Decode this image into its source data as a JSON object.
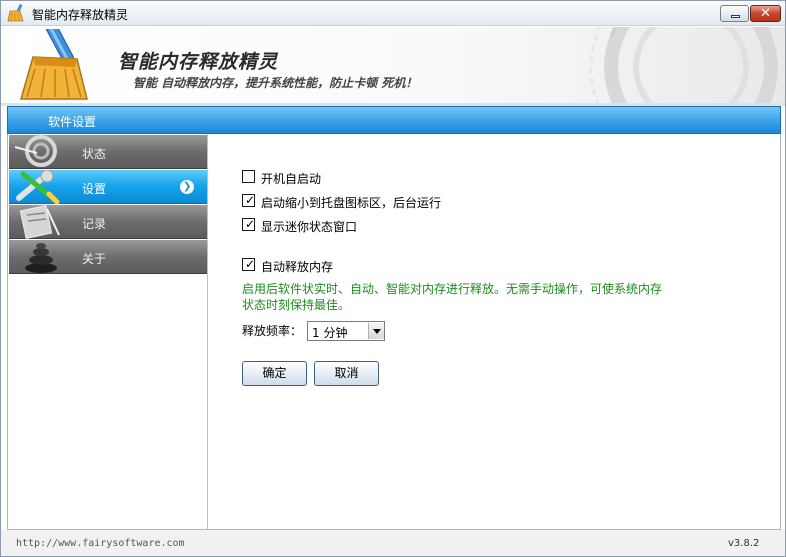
{
  "window": {
    "title": "智能内存释放精灵"
  },
  "header": {
    "app_name": "智能内存释放精灵",
    "slogan": "智能 自动释放内存，提升系统性能，防止卡顿 死机！"
  },
  "section": {
    "label": "软件设置"
  },
  "sidebar": {
    "items": [
      {
        "label": "状态",
        "icon": "status-icon",
        "active": false
      },
      {
        "label": "设置",
        "icon": "settings-icon",
        "active": true
      },
      {
        "label": "记录",
        "icon": "log-icon",
        "active": false
      },
      {
        "label": "关于",
        "icon": "about-icon",
        "active": false
      }
    ]
  },
  "settings": {
    "options": [
      {
        "label": "开机自启动",
        "checked": false
      },
      {
        "label": "启动缩小到托盘图标区，后台运行",
        "checked": true
      },
      {
        "label": "显示迷你状态窗口",
        "checked": true
      },
      {
        "label": "自动释放内存",
        "checked": true
      }
    ],
    "description": "启用后软件状实时、自动、智能对内存进行释放。无需手动操作，可使系统内存状态时刻保持最佳。",
    "frequency_label": "释放频率：",
    "frequency_value": "1 分钟",
    "ok_label": "确定",
    "cancel_label": "取消"
  },
  "footer": {
    "url": "http://www.fairysoftware.com",
    "version": "v3.8.2"
  },
  "colors": {
    "accent_blue": "#1a87d6",
    "description_green": "#1e8c1e",
    "close_red": "#c9452b"
  }
}
